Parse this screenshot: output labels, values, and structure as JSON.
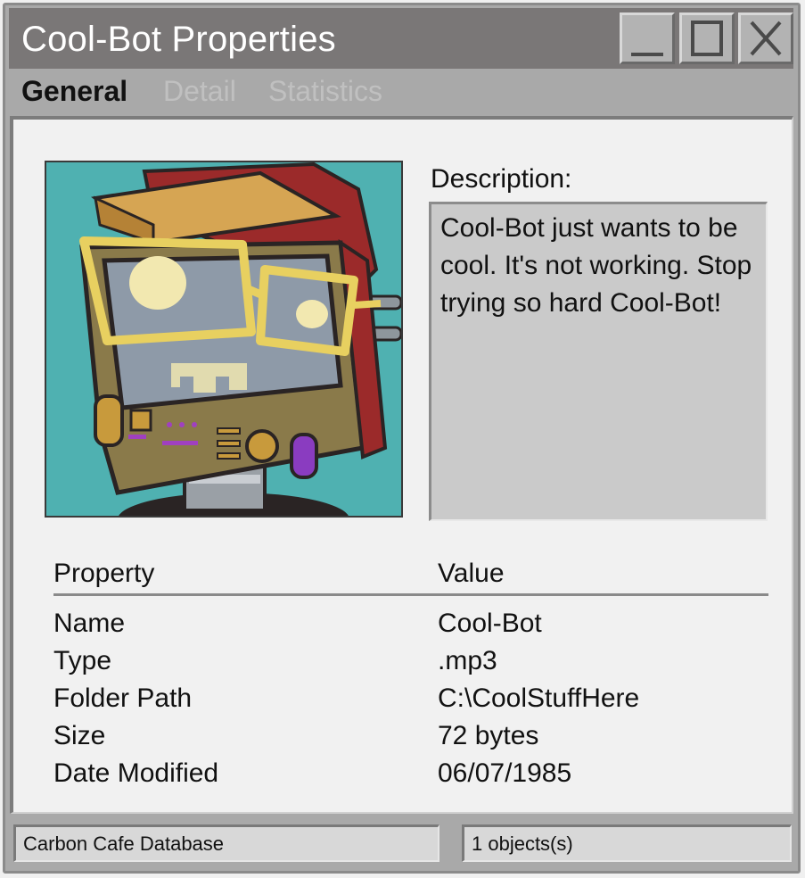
{
  "window": {
    "title": "Cool-Bot Properties",
    "controls": {
      "minimize": "minimize-icon",
      "maximize": "maximize-icon",
      "close": "close-icon"
    }
  },
  "tabs": [
    {
      "label": "General",
      "active": true
    },
    {
      "label": "Detail",
      "active": false
    },
    {
      "label": "Statistics",
      "active": false
    }
  ],
  "preview": {
    "subject": "cool-bot-robot-illustration"
  },
  "description": {
    "label": "Description:",
    "text": "Cool-Bot just wants to be cool. It's not working. Stop trying so hard Cool-Bot!"
  },
  "properties": {
    "headers": {
      "property": "Property",
      "value": "Value"
    },
    "rows": [
      {
        "key": "Name",
        "value": "Cool-Bot"
      },
      {
        "key": "Type",
        "value": ".mp3"
      },
      {
        "key": "Folder Path",
        "value": "C:\\CoolStuffHere"
      },
      {
        "key": "Size",
        "value": "72 bytes"
      },
      {
        "key": "Date Modified",
        "value": "06/07/1985"
      }
    ]
  },
  "status": {
    "left": "Carbon Cafe Database",
    "right": "1 objects(s)"
  },
  "colors": {
    "titlebar": "#7a7777",
    "window_frame": "#a9a9a9",
    "panel": "#f1f1f1",
    "image_background": "#4fb1b1"
  }
}
